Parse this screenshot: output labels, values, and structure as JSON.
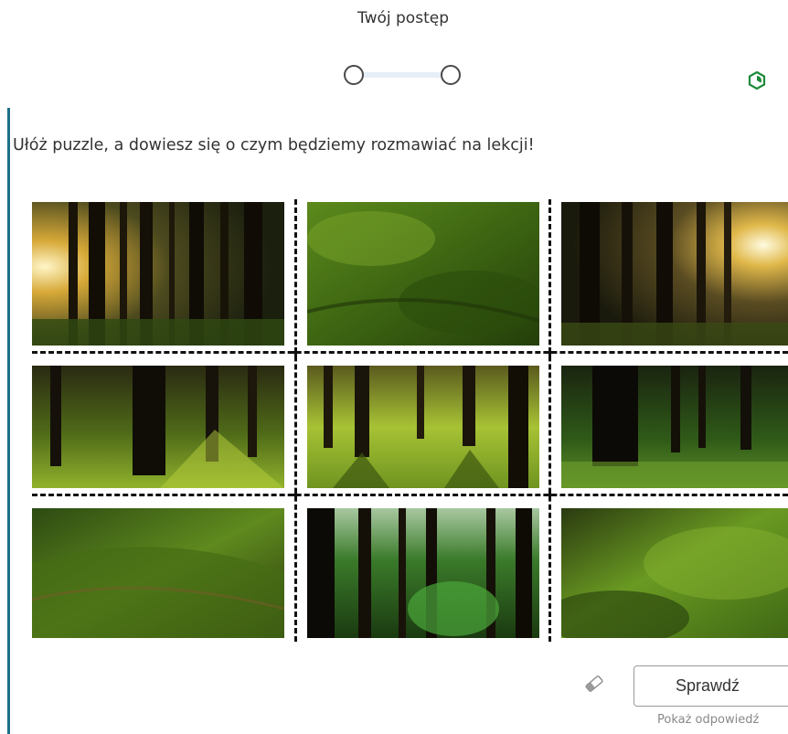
{
  "progress": {
    "title": "Twój postęp",
    "steps_completed": 0,
    "steps_total": 2
  },
  "exercise": {
    "instruction": "Ułóż puzzle, a dowiesz się o czym będziemy rozmawiać na lekcji!",
    "tiles": [
      {
        "row": 1,
        "col": 1,
        "scene": "tall dark trunks, sunlight from left"
      },
      {
        "row": 1,
        "col": 2,
        "scene": "mossy green ground"
      },
      {
        "row": 1,
        "col": 3,
        "scene": "dark trunks, sunburst right"
      },
      {
        "row": 2,
        "col": 1,
        "scene": "large trunk, sunlit grass"
      },
      {
        "row": 2,
        "col": 2,
        "scene": "bright green forest floor with shadows"
      },
      {
        "row": 2,
        "col": 3,
        "scene": "dark trunks, green undergrowth"
      },
      {
        "row": 3,
        "col": 1,
        "scene": "slope with grass and moss"
      },
      {
        "row": 3,
        "col": 2,
        "scene": "thin trunks, bright sky gap"
      },
      {
        "row": 3,
        "col": 3,
        "scene": "dense green moss"
      }
    ]
  },
  "controls": {
    "check_label": "Sprawdź",
    "show_answer_label": "Pokaż odpowiedź",
    "eraser_icon": "eraser-icon",
    "hint_icon": "hexagon-icon"
  },
  "colors": {
    "accent_bar": "#1f6e8c",
    "hint_icon": "#1d8a3a"
  }
}
